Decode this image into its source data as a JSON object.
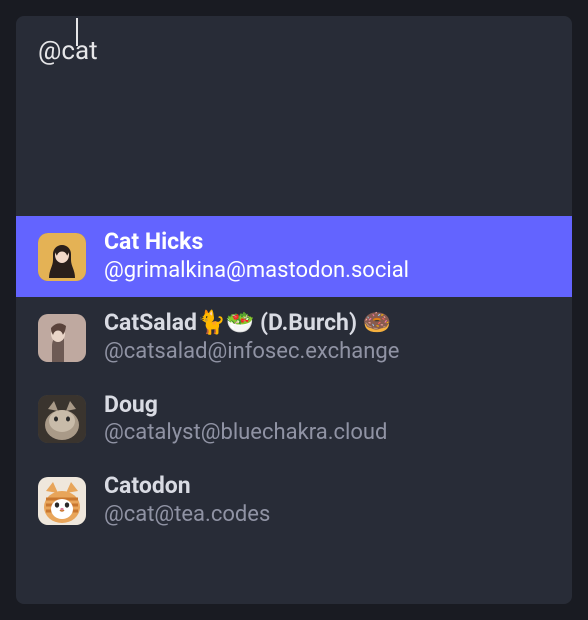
{
  "compose": {
    "text": "@cat"
  },
  "suggestions": [
    {
      "display_name": "Cat Hicks",
      "handle": "@grimalkina@mastodon.social",
      "selected": true
    },
    {
      "display_name": "CatSalad🐈🥗 (D.Burch) 🍩",
      "handle": "@catsalad@infosec.exchange",
      "selected": false
    },
    {
      "display_name": "Doug",
      "handle": "@catalyst@bluechakra.cloud",
      "selected": false
    },
    {
      "display_name": "Catodon",
      "handle": "@cat@tea.codes",
      "selected": false
    }
  ]
}
